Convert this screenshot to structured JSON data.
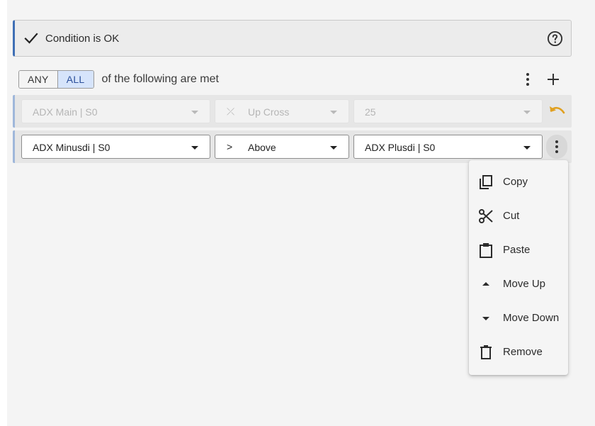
{
  "status": {
    "message": "Condition is OK",
    "accent_color": "#3f6fb5",
    "icon": "check-icon",
    "help_icon": "help-circle-icon"
  },
  "logic": {
    "options": [
      "ANY",
      "ALL"
    ],
    "selected": "ALL",
    "text": "of the following are met"
  },
  "conditions": [
    {
      "state": "disabled",
      "left": "ADX Main | S0",
      "operator_symbol": "⤫",
      "operator": "Up Cross",
      "right": "25",
      "action_icon": "undo-icon",
      "action_color": "#e0a020"
    },
    {
      "state": "active",
      "left": "ADX Minusdi | S0",
      "operator_symbol": ">",
      "operator": "Above",
      "right": "ADX Plusdi | S0",
      "action_icon": "more-vertical-icon"
    }
  ],
  "context_menu": {
    "items": [
      {
        "label": "Copy",
        "icon": "copy-icon"
      },
      {
        "label": "Cut",
        "icon": "scissors-icon"
      },
      {
        "label": "Paste",
        "icon": "clipboard-icon"
      },
      {
        "label": "Move Up",
        "icon": "arrow-up-icon"
      },
      {
        "label": "Move Down",
        "icon": "arrow-down-icon"
      },
      {
        "label": "Remove",
        "icon": "trash-icon"
      }
    ]
  }
}
